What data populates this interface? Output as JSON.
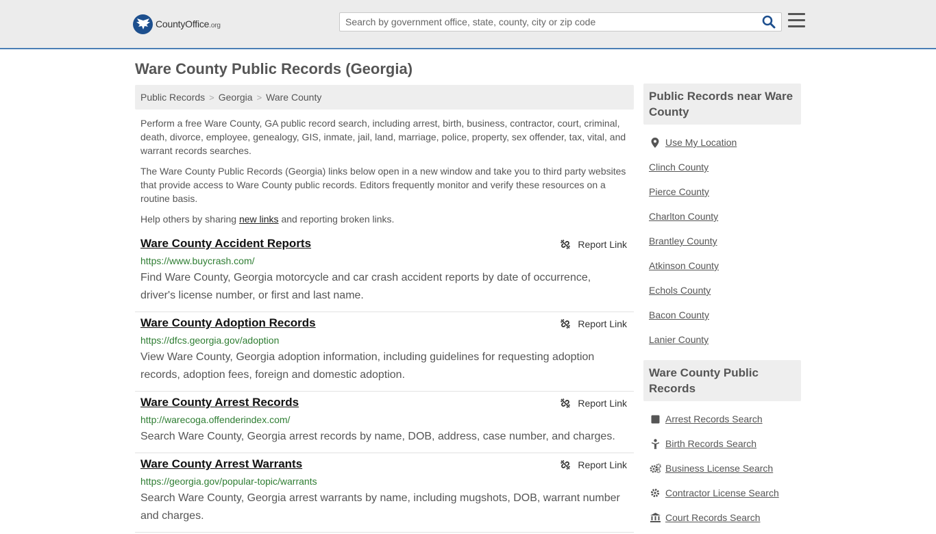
{
  "header": {
    "logo_name": "CountyOffice",
    "logo_tld": ".org",
    "search_placeholder": "Search by government office, state, county, city or zip code"
  },
  "page": {
    "title": "Ware County Public Records (Georgia)"
  },
  "breadcrumb": [
    {
      "label": "Public Records"
    },
    {
      "label": "Georgia"
    },
    {
      "label": "Ware County"
    }
  ],
  "intro": {
    "p1": "Perform a free Ware County, GA public record search, including arrest, birth, business, contractor, court, criminal, death, divorce, employee, genealogy, GIS, inmate, jail, land, marriage, police, property, sex offender, tax, vital, and warrant records searches.",
    "p2": "The Ware County Public Records (Georgia) links below open in a new window and take you to third party websites that provide access to Ware County public records. Editors frequently monitor and verify these resources on a routine basis.",
    "p3_pre": "Help others by sharing ",
    "p3_link": "new links",
    "p3_post": " and reporting broken links."
  },
  "records": [
    {
      "title": "Ware County Accident Reports",
      "url": "https://www.buycrash.com/",
      "desc": "Find Ware County, Georgia motorcycle and car crash accident reports by date of occurrence, driver's license number, or first and last name.",
      "report": "Report Link"
    },
    {
      "title": "Ware County Adoption Records",
      "url": "https://dfcs.georgia.gov/adoption",
      "desc": "View Ware County, Georgia adoption information, including guidelines for requesting adoption records, adoption fees, foreign and domestic adoption.",
      "report": "Report Link"
    },
    {
      "title": "Ware County Arrest Records",
      "url": "http://warecoga.offenderindex.com/",
      "desc": "Search Ware County, Georgia arrest records by name, DOB, address, case number, and charges.",
      "report": "Report Link"
    },
    {
      "title": "Ware County Arrest Warrants",
      "url": "https://georgia.gov/popular-topic/warrants",
      "desc": "Search Ware County, Georgia arrest warrants by name, including mugshots, DOB, warrant number and charges.",
      "report": "Report Link"
    }
  ],
  "sidebar": {
    "nearby_title": "Public Records near Ware County",
    "use_location": "Use My Location",
    "nearby": [
      "Clinch County",
      "Pierce County",
      "Charlton County",
      "Brantley County",
      "Atkinson County",
      "Echols County",
      "Bacon County",
      "Lanier County"
    ],
    "records_title": "Ware County Public Records",
    "record_links": [
      {
        "label": "Arrest Records Search",
        "icon": "arrest-icon"
      },
      {
        "label": "Birth Records Search",
        "icon": "baby-icon"
      },
      {
        "label": "Business License Search",
        "icon": "cogs-icon"
      },
      {
        "label": "Contractor License Search",
        "icon": "gear-icon"
      },
      {
        "label": "Court Records Search",
        "icon": "courthouse-icon"
      }
    ]
  }
}
